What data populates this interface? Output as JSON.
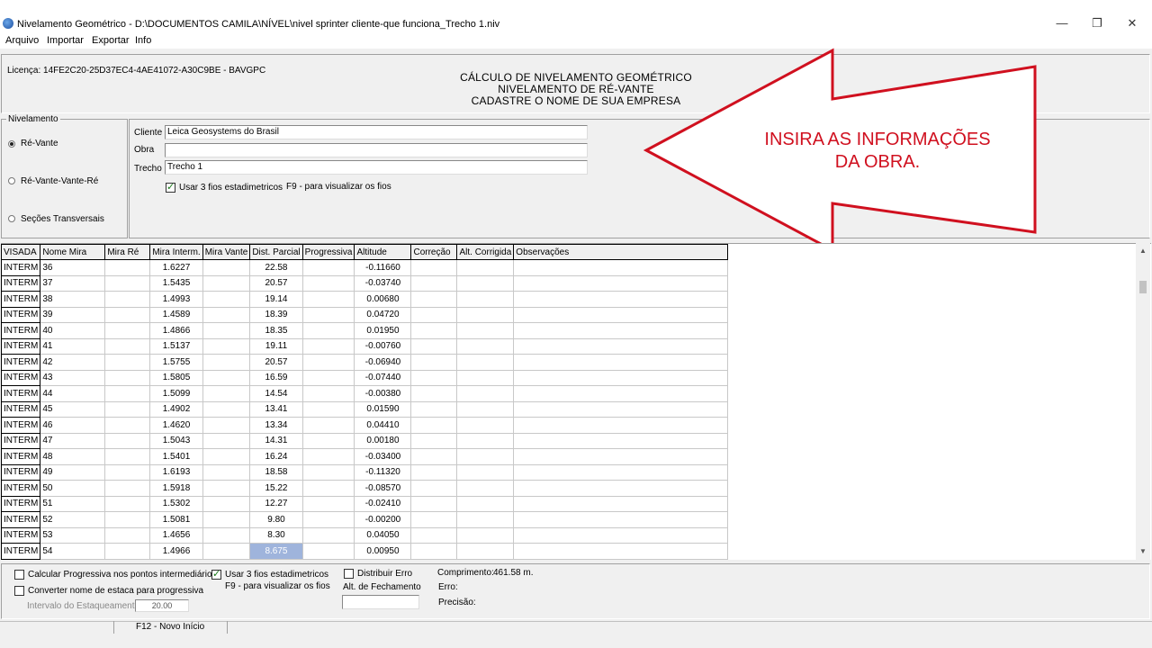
{
  "window": {
    "title": "Nivelamento Geométrico - D:\\DOCUMENTOS CAMILA\\NÍVEL\\nivel sprinter cliente-que funciona_Trecho 1.niv",
    "controls": {
      "minimize": "—",
      "restore": "❐",
      "close": "✕"
    }
  },
  "menu": {
    "items": [
      "Arquivo",
      "Importar",
      "Exportar",
      "Info"
    ]
  },
  "header": {
    "license": "Licença: 14FE2C20-25D37EC4-4AE41072-A30C9BE - BAVGPC",
    "line1": "CÁLCULO DE NIVELAMENTO GEOMÉTRICO",
    "line2": "NIVELAMENTO DE RÉ-VANTE",
    "line3": "CADASTRE O NOME DE SUA EMPRESA"
  },
  "nivelamento": {
    "title": "Nivelamento",
    "options": [
      "Ré-Vante",
      "Ré-Vante-Vante-Ré",
      "Seções Transversais"
    ],
    "selected": "Ré-Vante"
  },
  "info": {
    "cliente_label": "Cliente",
    "cliente_value": "Leica Geosystems do Brasil",
    "obra_label": "Obra",
    "obra_value": "",
    "trecho_label": "Trecho",
    "trecho_value": "Trecho 1",
    "usar_fios_label": "Usar 3 fios estadimetricos",
    "usar_fios_checked": true,
    "f9_hint": "F9 - para visualizar os fios"
  },
  "annotation": {
    "line1": "INSIRA AS INFORMAÇÕES",
    "line2": "DA OBRA.",
    "color": "#d0101f"
  },
  "grid": {
    "columns": [
      "VISADA",
      "Nome Mira",
      "Mira Ré",
      "Mira Interm.",
      "Mira Vante",
      "Dist. Parcial",
      "Progressiva",
      "Altitude",
      "Correção",
      "Alt. Corrigida",
      "Observações"
    ],
    "rows": [
      [
        "INTERM",
        "36",
        "",
        "1.6227",
        "",
        "22.58",
        "",
        "-0.11660",
        "",
        "",
        ""
      ],
      [
        "INTERM",
        "37",
        "",
        "1.5435",
        "",
        "20.57",
        "",
        "-0.03740",
        "",
        "",
        ""
      ],
      [
        "INTERM",
        "38",
        "",
        "1.4993",
        "",
        "19.14",
        "",
        "0.00680",
        "",
        "",
        ""
      ],
      [
        "INTERM",
        "39",
        "",
        "1.4589",
        "",
        "18.39",
        "",
        "0.04720",
        "",
        "",
        ""
      ],
      [
        "INTERM",
        "40",
        "",
        "1.4866",
        "",
        "18.35",
        "",
        "0.01950",
        "",
        "",
        ""
      ],
      [
        "INTERM",
        "41",
        "",
        "1.5137",
        "",
        "19.11",
        "",
        "-0.00760",
        "",
        "",
        ""
      ],
      [
        "INTERM",
        "42",
        "",
        "1.5755",
        "",
        "20.57",
        "",
        "-0.06940",
        "",
        "",
        ""
      ],
      [
        "INTERM",
        "43",
        "",
        "1.5805",
        "",
        "16.59",
        "",
        "-0.07440",
        "",
        "",
        ""
      ],
      [
        "INTERM",
        "44",
        "",
        "1.5099",
        "",
        "14.54",
        "",
        "-0.00380",
        "",
        "",
        ""
      ],
      [
        "INTERM",
        "45",
        "",
        "1.4902",
        "",
        "13.41",
        "",
        "0.01590",
        "",
        "",
        ""
      ],
      [
        "INTERM",
        "46",
        "",
        "1.4620",
        "",
        "13.34",
        "",
        "0.04410",
        "",
        "",
        ""
      ],
      [
        "INTERM",
        "47",
        "",
        "1.5043",
        "",
        "14.31",
        "",
        "0.00180",
        "",
        "",
        ""
      ],
      [
        "INTERM",
        "48",
        "",
        "1.5401",
        "",
        "16.24",
        "",
        "-0.03400",
        "",
        "",
        ""
      ],
      [
        "INTERM",
        "49",
        "",
        "1.6193",
        "",
        "18.58",
        "",
        "-0.11320",
        "",
        "",
        ""
      ],
      [
        "INTERM",
        "50",
        "",
        "1.5918",
        "",
        "15.22",
        "",
        "-0.08570",
        "",
        "",
        ""
      ],
      [
        "INTERM",
        "51",
        "",
        "1.5302",
        "",
        "12.27",
        "",
        "-0.02410",
        "",
        "",
        ""
      ],
      [
        "INTERM",
        "52",
        "",
        "1.5081",
        "",
        "9.80",
        "",
        "-0.00200",
        "",
        "",
        ""
      ],
      [
        "INTERM",
        "53",
        "",
        "1.4656",
        "",
        "8.30",
        "",
        "0.04050",
        "",
        "",
        ""
      ],
      [
        "INTERM",
        "54",
        "",
        "1.4966",
        "",
        "8.675",
        "",
        "0.00950",
        "",
        "",
        ""
      ]
    ],
    "selected_row": 18,
    "selected_col": 5,
    "selection_color": "#9fb4dc"
  },
  "options": {
    "calc_progressiva_label": "Calcular Progressiva nos pontos intermediários",
    "calc_progressiva_checked": false,
    "converter_label": "Converter nome de estaca para progressiva",
    "converter_checked": false,
    "intervalo_label": "Intervalo do Estaqueamento",
    "intervalo_value": "20.00",
    "usar_fios_label": "Usar 3 fios estadimetricos",
    "usar_fios_checked": true,
    "f9_hint": "F9 - para visualizar os fios",
    "distribuir_label": "Distribuir Erro",
    "distribuir_checked": false,
    "alt_fechamento_label": "Alt. de Fechamento",
    "comprimento_label": "Comprimento:",
    "comprimento_value": "461.58 m.",
    "erro_label": "Erro:",
    "precisao_label": "Precisão:"
  },
  "status": {
    "f12": "F12 - Novo Início"
  }
}
